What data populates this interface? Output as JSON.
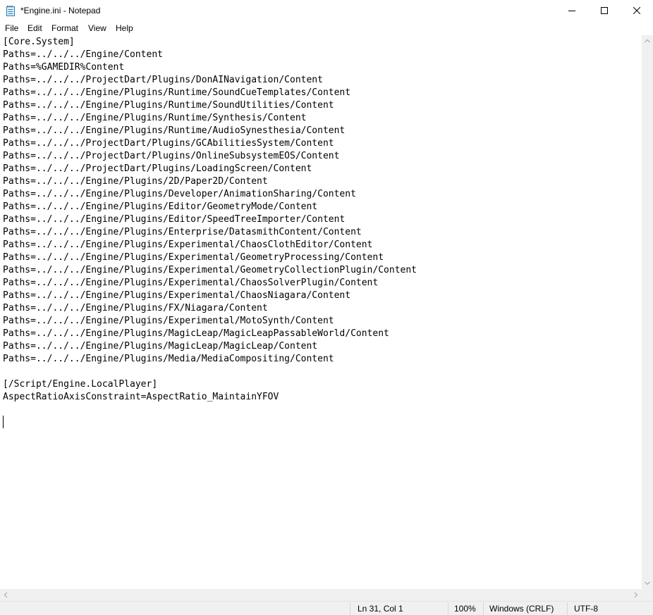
{
  "window": {
    "title": "*Engine.ini - Notepad",
    "icon": "notepad-icon",
    "controls": {
      "minimize": "minimize-icon",
      "maximize": "maximize-icon",
      "close": "close-icon"
    }
  },
  "menu": {
    "file": "File",
    "edit": "Edit",
    "format": "Format",
    "view": "View",
    "help": "Help"
  },
  "editor": {
    "content": "[Core.System]\nPaths=../../../Engine/Content\nPaths=%GAMEDIR%Content\nPaths=../../../ProjectDart/Plugins/DonAINavigation/Content\nPaths=../../../Engine/Plugins/Runtime/SoundCueTemplates/Content\nPaths=../../../Engine/Plugins/Runtime/SoundUtilities/Content\nPaths=../../../Engine/Plugins/Runtime/Synthesis/Content\nPaths=../../../Engine/Plugins/Runtime/AudioSynesthesia/Content\nPaths=../../../ProjectDart/Plugins/GCAbilitiesSystem/Content\nPaths=../../../ProjectDart/Plugins/OnlineSubsystemEOS/Content\nPaths=../../../ProjectDart/Plugins/LoadingScreen/Content\nPaths=../../../Engine/Plugins/2D/Paper2D/Content\nPaths=../../../Engine/Plugins/Developer/AnimationSharing/Content\nPaths=../../../Engine/Plugins/Editor/GeometryMode/Content\nPaths=../../../Engine/Plugins/Editor/SpeedTreeImporter/Content\nPaths=../../../Engine/Plugins/Enterprise/DatasmithContent/Content\nPaths=../../../Engine/Plugins/Experimental/ChaosClothEditor/Content\nPaths=../../../Engine/Plugins/Experimental/GeometryProcessing/Content\nPaths=../../../Engine/Plugins/Experimental/GeometryCollectionPlugin/Content\nPaths=../../../Engine/Plugins/Experimental/ChaosSolverPlugin/Content\nPaths=../../../Engine/Plugins/Experimental/ChaosNiagara/Content\nPaths=../../../Engine/Plugins/FX/Niagara/Content\nPaths=../../../Engine/Plugins/Experimental/MotoSynth/Content\nPaths=../../../Engine/Plugins/MagicLeap/MagicLeapPassableWorld/Content\nPaths=../../../Engine/Plugins/MagicLeap/MagicLeap/Content\nPaths=../../../Engine/Plugins/Media/MediaCompositing/Content\n\n[/Script/Engine.LocalPlayer]\nAspectRatioAxisConstraint=AspectRatio_MaintainYFOV\n\n"
  },
  "status": {
    "position": "Ln 31, Col 1",
    "zoom": "100%",
    "line_ending": "Windows (CRLF)",
    "encoding": "UTF-8"
  }
}
